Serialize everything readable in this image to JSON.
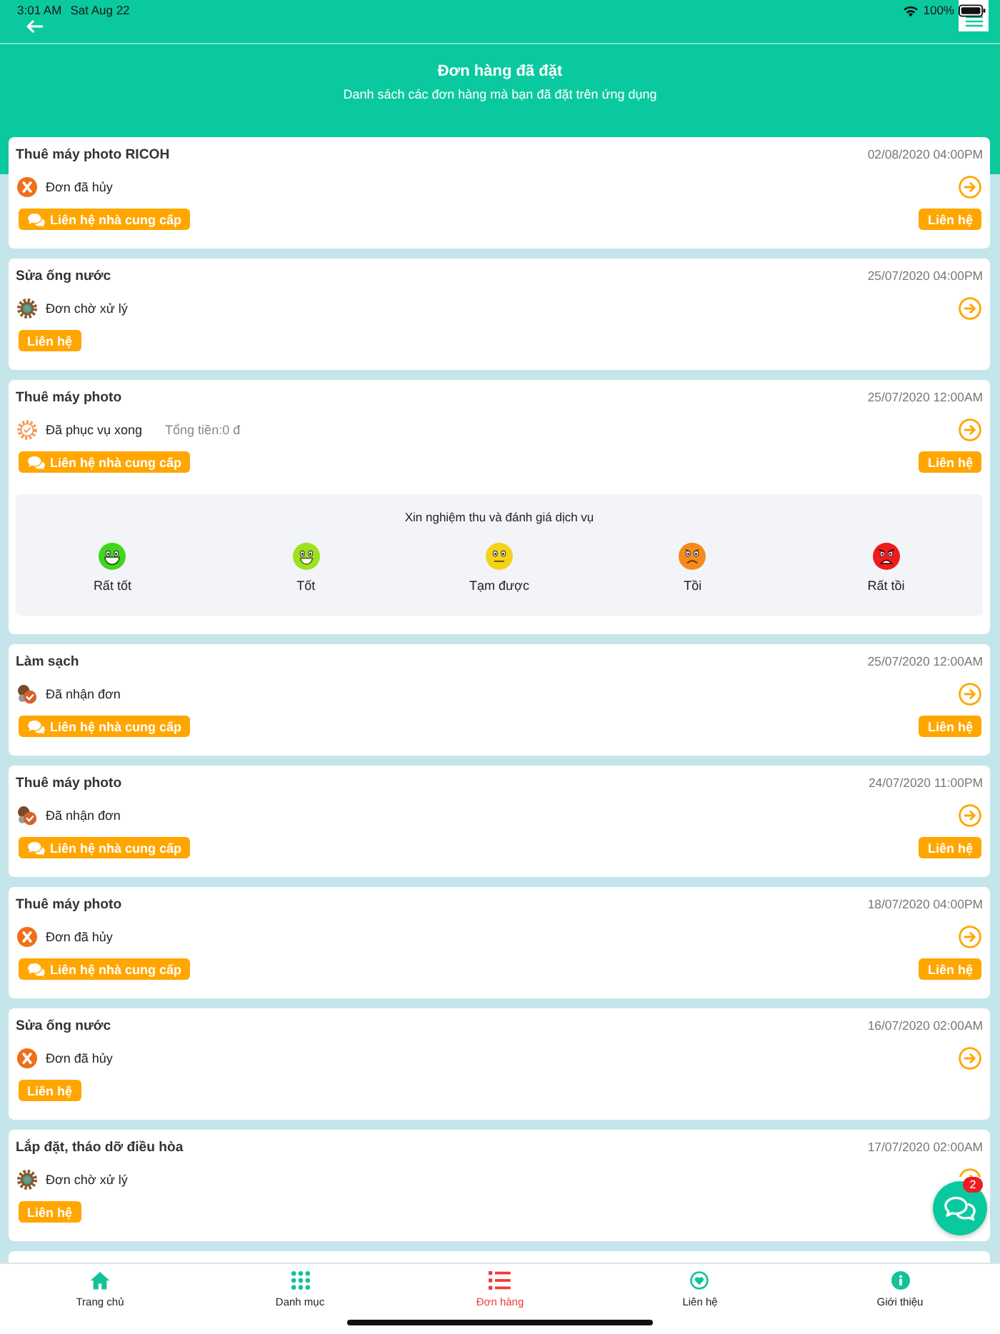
{
  "status_bar": {
    "time": "3:01 AM",
    "date": "Sat Aug 22",
    "battery": "100%"
  },
  "header": {
    "title": "Đơn hàng đã đặt",
    "subtitle": "Danh sách các đơn hàng mà bạn đã đặt trên ứng dụng"
  },
  "orders": [
    {
      "title": "Thuê máy photo RICOH",
      "date": "02/08/2020 04:00PM",
      "status": {
        "kind": "cancelled",
        "label": "Đơn đã hủy"
      },
      "buttons": [
        {
          "kind": "supplier",
          "label": "Liên hệ nhà cung cấp"
        },
        {
          "kind": "contact",
          "label": "Liên hệ"
        }
      ]
    },
    {
      "title": "Sửa ống nước",
      "date": "25/07/2020 04:00PM",
      "status": {
        "kind": "pending",
        "label": "Đơn chờ xử lý"
      },
      "buttons": [
        {
          "kind": "contact",
          "label": "Liên hệ"
        }
      ]
    },
    {
      "title": "Thuê máy photo",
      "date": "25/07/2020 12:00AM",
      "status": {
        "kind": "completed",
        "label": "Đã phục vụ xong"
      },
      "total": "Tổng tiền:0 đ",
      "buttons": [
        {
          "kind": "supplier",
          "label": "Liên hệ nhà cung cấp"
        },
        {
          "kind": "contact",
          "label": "Liên hệ"
        }
      ],
      "rating": {
        "prompt": "Xin nghiệm thu và đánh giá dịch vụ",
        "options": [
          {
            "kind": "grin",
            "label": "Rất tốt",
            "color": "#3fd61d"
          },
          {
            "kind": "smile",
            "label": "Tốt",
            "color": "#9de21f"
          },
          {
            "kind": "neutral",
            "label": "Tạm được",
            "color": "#f4d41a"
          },
          {
            "kind": "sad",
            "label": "Tồi",
            "color": "#f58a1e"
          },
          {
            "kind": "angry",
            "label": "Rất tồi",
            "color": "#ee1c1c"
          }
        ]
      }
    },
    {
      "title": "Làm sạch",
      "date": "25/07/2020 12:00AM",
      "status": {
        "kind": "received",
        "label": "Đã nhận đơn"
      },
      "buttons": [
        {
          "kind": "supplier",
          "label": "Liên hệ nhà cung cấp"
        },
        {
          "kind": "contact",
          "label": "Liên hệ"
        }
      ]
    },
    {
      "title": "Thuê máy photo",
      "date": "24/07/2020 11:00PM",
      "status": {
        "kind": "received",
        "label": "Đã nhận đơn"
      },
      "buttons": [
        {
          "kind": "supplier",
          "label": "Liên hệ nhà cung cấp"
        },
        {
          "kind": "contact",
          "label": "Liên hệ"
        }
      ]
    },
    {
      "title": "Thuê máy photo",
      "date": "18/07/2020 04:00PM",
      "status": {
        "kind": "cancelled",
        "label": "Đơn đã hủy"
      },
      "buttons": [
        {
          "kind": "supplier",
          "label": "Liên hệ nhà cung cấp"
        },
        {
          "kind": "contact",
          "label": "Liên hệ"
        }
      ]
    },
    {
      "title": "Sửa ống nước",
      "date": "16/07/2020 02:00AM",
      "status": {
        "kind": "cancelled",
        "label": "Đơn đã hủy"
      },
      "buttons": [
        {
          "kind": "contact",
          "label": "Liên hệ"
        }
      ]
    },
    {
      "title": "Lắp đặt, tháo dỡ điều hòa",
      "date": "17/07/2020 02:00AM",
      "status": {
        "kind": "pending",
        "label": "Đơn chờ xử lý"
      },
      "buttons": [
        {
          "kind": "contact",
          "label": "Liên hệ"
        }
      ]
    }
  ],
  "chat_button": {
    "badge": "2"
  },
  "tab_bar": [
    {
      "kind": "home",
      "label": "Trang chủ",
      "selected": false
    },
    {
      "kind": "grid",
      "label": "Danh mục",
      "selected": false
    },
    {
      "kind": "list",
      "label": "Đơn hàng",
      "selected": true
    },
    {
      "kind": "heart",
      "label": "Liên hệ",
      "selected": false
    },
    {
      "kind": "info",
      "label": "Giới thiệu",
      "selected": false
    }
  ]
}
